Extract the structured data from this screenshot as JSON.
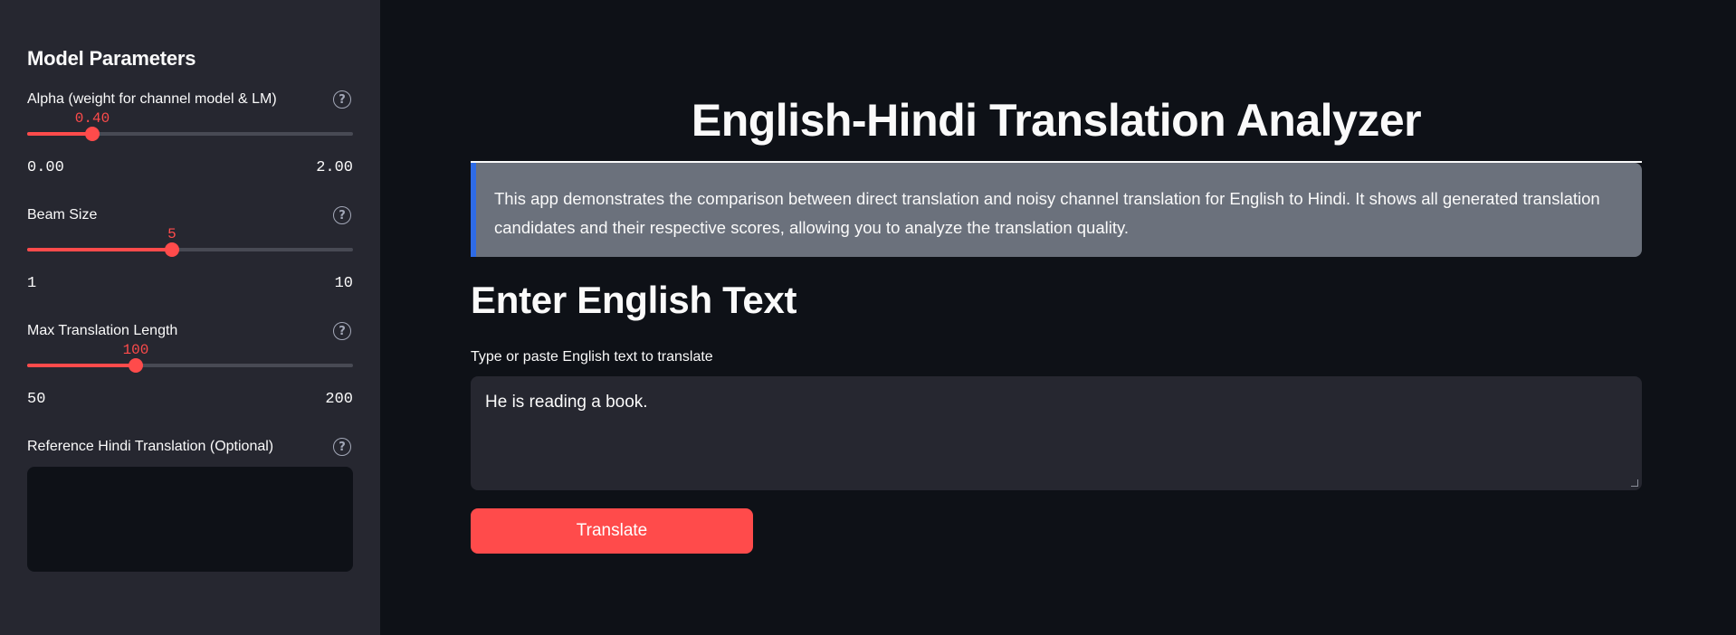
{
  "sidebar": {
    "title": "Model Parameters",
    "alpha": {
      "label": "Alpha (weight for channel model & LM)",
      "value": "0.40",
      "min": "0.00",
      "max": "2.00",
      "fraction": 0.2
    },
    "beam": {
      "label": "Beam Size",
      "value": "5",
      "min": "1",
      "max": "10",
      "fraction": 0.4444
    },
    "maxlen": {
      "label": "Max Translation Length",
      "value": "100",
      "min": "50",
      "max": "200",
      "fraction": 0.3333
    },
    "reference": {
      "label": "Reference Hindi Translation (Optional)",
      "value": ""
    }
  },
  "main": {
    "title": "English-Hindi Translation Analyzer",
    "info": "This app demonstrates the comparison between direct translation and noisy channel translation for English to Hindi. It shows all generated translation candidates and their respective scores, allowing you to analyze the translation quality.",
    "heading": "Enter English Text",
    "input_label": "Type or paste English text to translate",
    "input_value": "He is reading a book.",
    "button_label": "Translate"
  },
  "colors": {
    "accent": "#ff4b4b",
    "info_border": "#2e6be6",
    "sidebar_bg": "#262730",
    "page_bg": "#0e1117"
  },
  "icons": {
    "help": "help-circle-icon"
  }
}
